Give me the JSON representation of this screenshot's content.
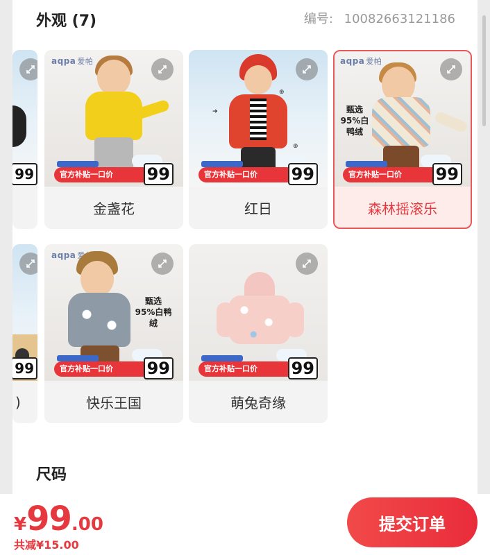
{
  "appearance": {
    "title": "外观 (7)",
    "code_label": "编号:",
    "code_value": "10082663121186"
  },
  "products": [
    {
      "name": "",
      "brand": "",
      "promo": "",
      "price_tag": "99",
      "selected": false
    },
    {
      "name": "金盏花",
      "brand": "aqpa",
      "brand_cn": "爱帕",
      "promo": "官方补贴一口价",
      "price_tag": "99",
      "selected": false
    },
    {
      "name": "红日",
      "brand": "",
      "promo": "官方补贴一口价",
      "price_tag": "99",
      "selected": false
    },
    {
      "name": "森林摇滚乐",
      "brand": "aqpa",
      "brand_cn": "爱帕",
      "promo": "官方补贴一口价",
      "price_tag": "99",
      "stamp": "甄选 95%白鸭绒",
      "selected": true
    },
    {
      "name": ")",
      "brand": "",
      "promo": "",
      "price_tag": "99",
      "selected": false
    },
    {
      "name": "快乐王国",
      "brand": "aqpa",
      "brand_cn": "爱帕",
      "promo": "官方补贴一口价",
      "price_tag": "99",
      "stamp": "甄选 95%白鸭绒",
      "selected": false
    },
    {
      "name": "萌兔奇缘",
      "brand": "",
      "promo": "官方补贴一口价",
      "price_tag": "99",
      "selected": false
    }
  ],
  "size_section": {
    "title": "尺码"
  },
  "footer": {
    "currency": "¥",
    "price_int": "99",
    "price_dec": ".00",
    "discount": "共减¥15.00",
    "submit_label": "提交订单"
  },
  "colors": {
    "accent": "#e6393f",
    "selected_bg": "#fdecea",
    "card_bg": "#f3f3f3"
  },
  "icons": {
    "expand": "expand-icon"
  }
}
